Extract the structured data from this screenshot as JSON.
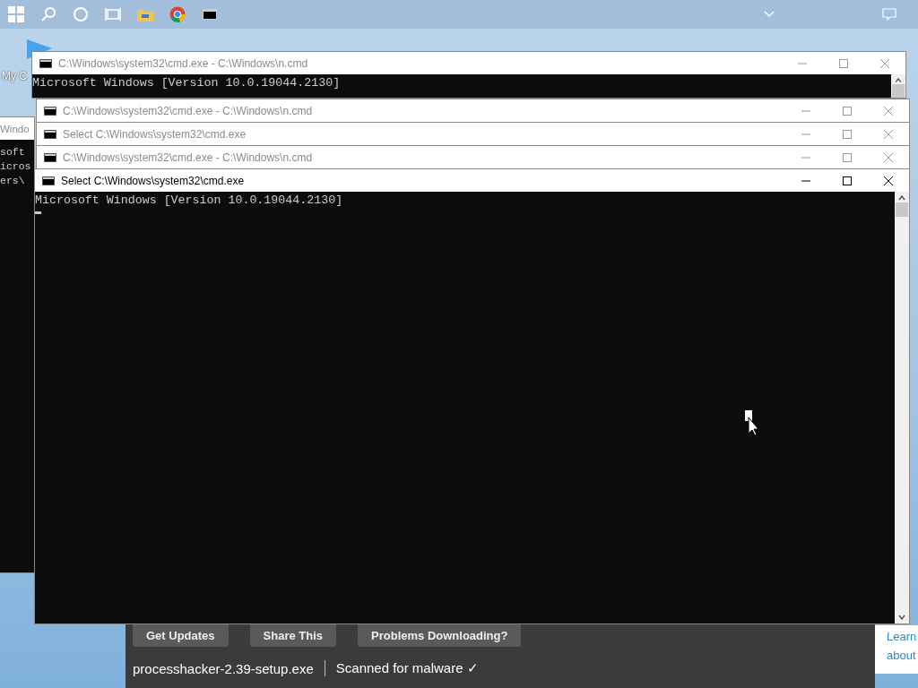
{
  "desktop_icon": {
    "label": "My C"
  },
  "background_window": {
    "title": "Windo",
    "console_lines": [
      "soft",
      "icros",
      "ers\\"
    ]
  },
  "cmd_windows": [
    {
      "title": "C:\\Windows\\system32\\cmd.exe - C:\\Windows\\n.cmd",
      "active": false,
      "console_lines": [
        "Microsoft Windows [Version 10.0.19044.2130]"
      ]
    },
    {
      "title": "C:\\Windows\\system32\\cmd.exe - C:\\Windows\\n.cmd",
      "active": false
    },
    {
      "title": "Select C:\\Windows\\system32\\cmd.exe",
      "active": false
    },
    {
      "title": "C:\\Windows\\system32\\cmd.exe - C:\\Windows\\n.cmd",
      "active": false
    },
    {
      "title": "Select C:\\Windows\\system32\\cmd.exe",
      "active": true,
      "console_lines": [
        "Microsoft Windows [Version 10.0.19044.2130]"
      ]
    }
  ],
  "browser_page": {
    "buttons": [
      "Get Updates",
      "Share This",
      "Problems Downloading?"
    ],
    "file_name": "processhacker-2.39-setup.exe",
    "scan_status": "Scanned for malware ✓",
    "side_link_lines": [
      "Learn",
      "about"
    ]
  }
}
